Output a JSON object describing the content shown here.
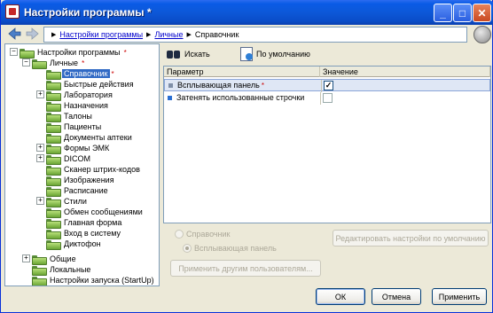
{
  "window": {
    "title": "Настройки программы *"
  },
  "titlebar": {
    "minimize": "_",
    "maximize": "□",
    "close": "✕"
  },
  "breadcrumb": {
    "items": [
      "Настройки программы",
      "Личные",
      "Справочник"
    ]
  },
  "tree": {
    "root": {
      "label": "Настройки программы",
      "modified": "*"
    },
    "personal": {
      "label": "Личные",
      "modified": "*"
    },
    "items": [
      {
        "label": "Справочник",
        "modified": "*",
        "selected": true,
        "expand": ""
      },
      {
        "label": "Быстрые действия",
        "expand": ""
      },
      {
        "label": "Лаборатория",
        "expand": "+"
      },
      {
        "label": "Назначения",
        "expand": ""
      },
      {
        "label": "Талоны",
        "expand": ""
      },
      {
        "label": "Пациенты",
        "expand": ""
      },
      {
        "label": "Документы аптеки",
        "expand": ""
      },
      {
        "label": "Формы ЭМК",
        "expand": "+"
      },
      {
        "label": "DICOM",
        "expand": "+"
      },
      {
        "label": "Сканер штрих-кодов",
        "expand": ""
      },
      {
        "label": "Изображения",
        "expand": ""
      },
      {
        "label": "Расписание",
        "expand": ""
      },
      {
        "label": "Стили",
        "expand": "+"
      },
      {
        "label": "Обмен сообщениями",
        "expand": ""
      },
      {
        "label": "Главная форма",
        "expand": ""
      },
      {
        "label": "Вход в систему",
        "expand": ""
      },
      {
        "label": "Диктофон",
        "expand": ""
      }
    ],
    "general": {
      "label": "Общие"
    },
    "local": {
      "label": "Локальные"
    },
    "startup": {
      "label": "Настройки запуска (StartUp)"
    }
  },
  "toolbar": {
    "search_label": "Искать",
    "default_label": "По умолчанию"
  },
  "grid": {
    "columns": [
      "Параметр",
      "Значение"
    ],
    "rows": [
      {
        "name": "Всплывающая панель",
        "modified": "*",
        "checked": true,
        "check_glyph": "✓"
      },
      {
        "name": "Затенять использованные строчки",
        "checked": false,
        "check_glyph": ""
      }
    ]
  },
  "lower": {
    "radio_reference": "Справочник",
    "radio_popup": "Всплывающая панель",
    "edit_defaults_button": "Редактировать настройки по умолчанию",
    "apply_others_button": "Применить другим пользователям..."
  },
  "footer": {
    "ok": "ОК",
    "cancel": "Отмена",
    "apply": "Применить"
  }
}
